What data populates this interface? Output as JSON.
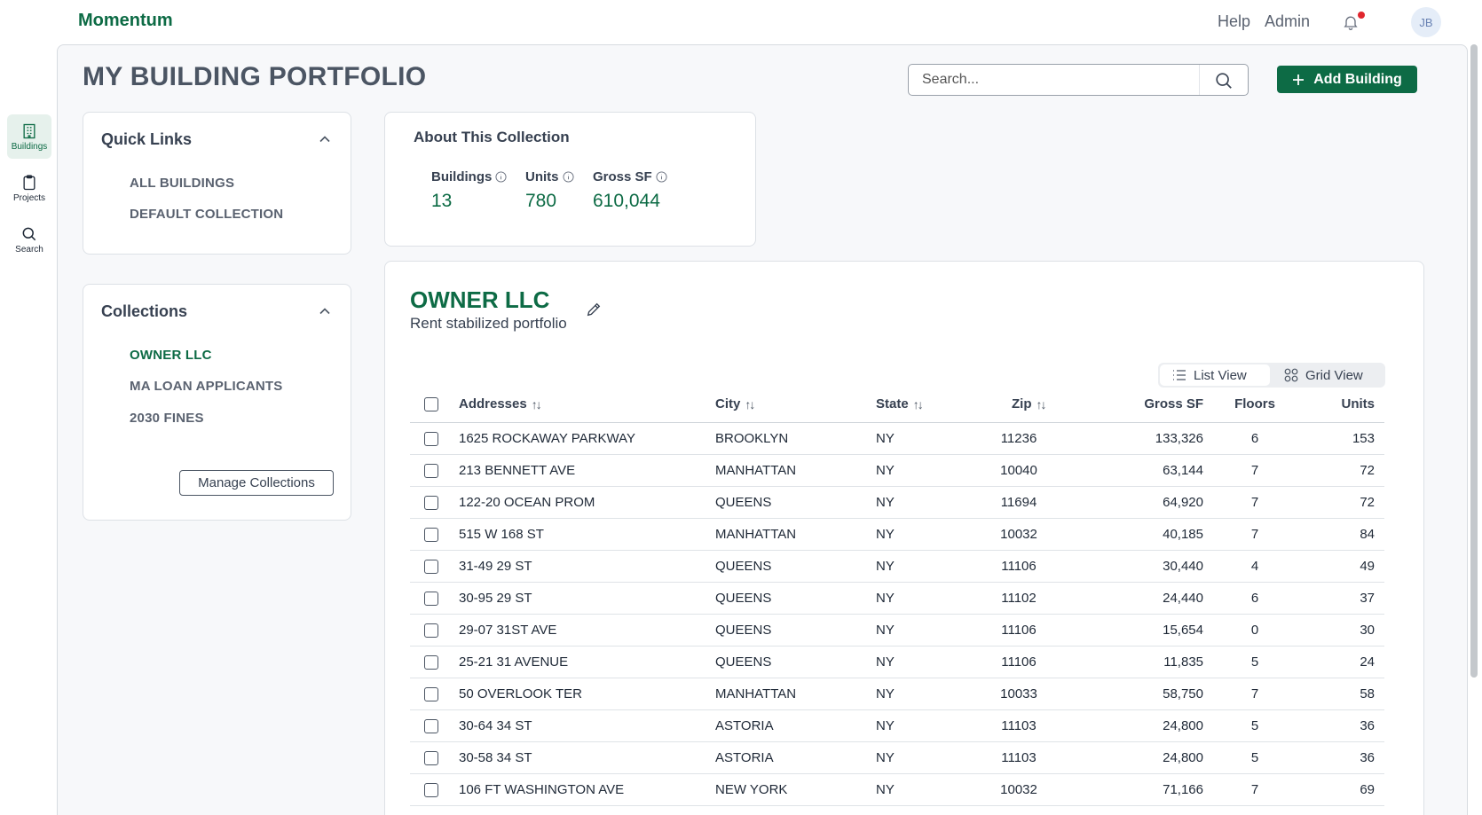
{
  "app": {
    "brand": "Momentum",
    "nav": {
      "help": "Help",
      "admin": "Admin"
    },
    "user_initials": "JB",
    "accent": "#0d6b45"
  },
  "rail": [
    {
      "label": "Buildings",
      "icon": "building-icon",
      "active": true
    },
    {
      "label": "Projects",
      "icon": "clipboard-icon",
      "active": false
    },
    {
      "label": "Search",
      "icon": "search-icon",
      "active": false
    }
  ],
  "page": {
    "title": "MY BUILDING PORTFOLIO"
  },
  "search": {
    "placeholder": "Search..."
  },
  "add_button": {
    "label": "Add Building"
  },
  "quick_links": {
    "title": "Quick Links",
    "items": [
      "ALL BUILDINGS",
      "DEFAULT COLLECTION"
    ]
  },
  "collections": {
    "title": "Collections",
    "items": [
      "OWNER LLC",
      "MA LOAN APPLICANTS",
      "2030 FINES"
    ],
    "active_index": 0,
    "manage_label": "Manage Collections"
  },
  "about": {
    "title": "About This Collection",
    "stats": [
      {
        "label": "Buildings",
        "value": "13"
      },
      {
        "label": "Units",
        "value": "780"
      },
      {
        "label": "Gross SF",
        "value": "610,044"
      }
    ]
  },
  "collection": {
    "name": "OWNER LLC",
    "description": "Rent stabilized portfolio",
    "views": {
      "list": "List View",
      "grid": "Grid View"
    },
    "table": {
      "headers": {
        "address": "Addresses",
        "city": "City",
        "state": "State",
        "zip": "Zip",
        "gross_sf": "Gross SF",
        "floors": "Floors",
        "units": "Units"
      },
      "rows": [
        {
          "address": "1625 ROCKAWAY PARKWAY",
          "city": "BROOKLYN",
          "state": "NY",
          "zip": "11236",
          "gross_sf": "133,326",
          "floors": "6",
          "units": "153"
        },
        {
          "address": "213 BENNETT AVE",
          "city": "MANHATTAN",
          "state": "NY",
          "zip": "10040",
          "gross_sf": "63,144",
          "floors": "7",
          "units": "72"
        },
        {
          "address": "122-20 OCEAN PROM",
          "city": "QUEENS",
          "state": "NY",
          "zip": "11694",
          "gross_sf": "64,920",
          "floors": "7",
          "units": "72"
        },
        {
          "address": "515 W 168 ST",
          "city": "MANHATTAN",
          "state": "NY",
          "zip": "10032",
          "gross_sf": "40,185",
          "floors": "7",
          "units": "84"
        },
        {
          "address": "31-49 29 ST",
          "city": "QUEENS",
          "state": "NY",
          "zip": "11106",
          "gross_sf": "30,440",
          "floors": "4",
          "units": "49"
        },
        {
          "address": "30-95 29 ST",
          "city": "QUEENS",
          "state": "NY",
          "zip": "11102",
          "gross_sf": "24,440",
          "floors": "6",
          "units": "37"
        },
        {
          "address": "29-07 31ST AVE",
          "city": "QUEENS",
          "state": "NY",
          "zip": "11106",
          "gross_sf": "15,654",
          "floors": "0",
          "units": "30"
        },
        {
          "address": "25-21 31 AVENUE",
          "city": "QUEENS",
          "state": "NY",
          "zip": "11106",
          "gross_sf": "11,835",
          "floors": "5",
          "units": "24"
        },
        {
          "address": "50 OVERLOOK TER",
          "city": "MANHATTAN",
          "state": "NY",
          "zip": "10033",
          "gross_sf": "58,750",
          "floors": "7",
          "units": "58"
        },
        {
          "address": "30-64 34 ST",
          "city": "ASTORIA",
          "state": "NY",
          "zip": "11103",
          "gross_sf": "24,800",
          "floors": "5",
          "units": "36"
        },
        {
          "address": "30-58 34 ST",
          "city": "ASTORIA",
          "state": "NY",
          "zip": "11103",
          "gross_sf": "24,800",
          "floors": "5",
          "units": "36"
        },
        {
          "address": "106 FT WASHINGTON AVE",
          "city": "NEW YORK",
          "state": "NY",
          "zip": "10032",
          "gross_sf": "71,166",
          "floors": "7",
          "units": "69"
        }
      ]
    }
  }
}
